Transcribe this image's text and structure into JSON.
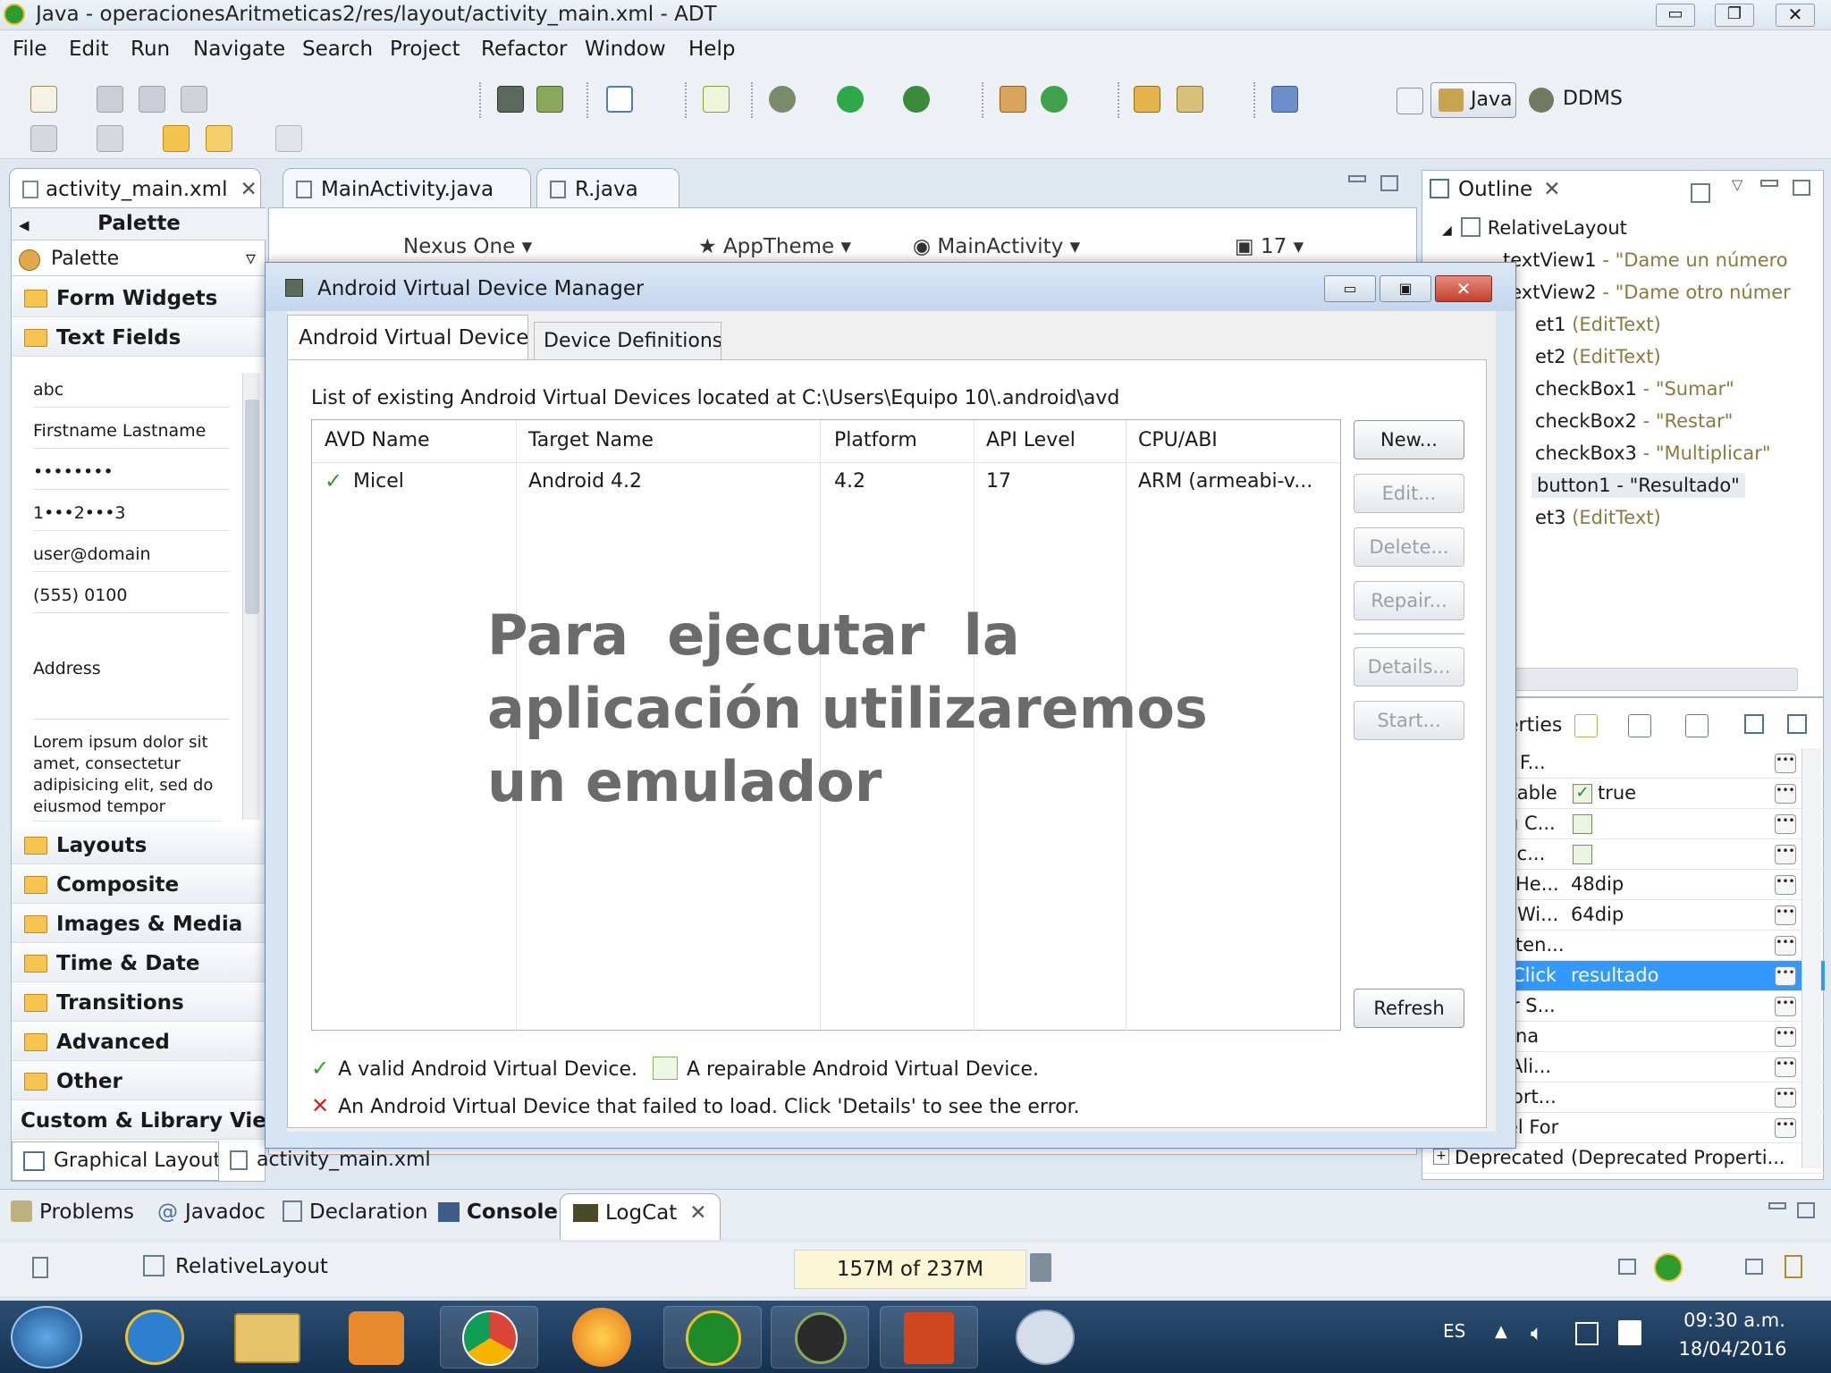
{
  "window": {
    "title": "Java - operacionesAritmeticas2/res/layout/activity_main.xml - ADT"
  },
  "menu": [
    "File",
    "Edit",
    "Run",
    "Navigate",
    "Search",
    "Project",
    "Refactor",
    "Window",
    "Help"
  ],
  "perspectives": {
    "java": "Java",
    "ddms": "DDMS"
  },
  "editor_tabs": [
    "activity_main.xml",
    "MainActivity.java",
    "R.java"
  ],
  "palette": {
    "header": "Palette",
    "dropdown_label": "Palette",
    "folders_top": [
      "Form Widgets",
      "Text Fields"
    ],
    "text_fields": [
      "abc",
      "Firstname Lastname",
      "••••••••",
      "1•••2•••3",
      "user@domain",
      "(555) 0100",
      "Address"
    ],
    "lorem": "Lorem ipsum dolor sit amet, consectetur adipisicing elit, sed do eiusmod tempor",
    "folders_bottom": [
      "Layouts",
      "Composite",
      "Images & Media",
      "Time & Date",
      "Transitions",
      "Advanced",
      "Other"
    ],
    "custom": "Custom & Library Views"
  },
  "editor_toolbar": {
    "device": "Nexus One",
    "theme": "AppTheme",
    "activity": "MainActivity",
    "api": "17"
  },
  "layout_tabs": [
    "Graphical Layout",
    "activity_main.xml"
  ],
  "outline": {
    "title": "Outline",
    "root": "RelativeLayout",
    "items": [
      {
        "id": "textView1",
        "desc": " - \"Dame un número"
      },
      {
        "id": "textView2",
        "desc": " - \"Dame otro númer"
      },
      {
        "id": "et1",
        "desc": " (EditText)"
      },
      {
        "id": "et2",
        "desc": " (EditText)"
      },
      {
        "id": "checkBox1",
        "desc": " - \"Sumar\""
      },
      {
        "id": "checkBox2",
        "desc": " - \"Restar\""
      },
      {
        "id": "checkBox3",
        "desc": " - \"Multiplicar\""
      },
      {
        "id": "button1",
        "desc": " - \"Resultado\""
      },
      {
        "id": "et3",
        "desc": " (EditText)"
      }
    ]
  },
  "properties": {
    "title": "erties",
    "rows": [
      {
        "name": "t F...",
        "value": ""
      },
      {
        "name": "kable",
        "value": "true"
      },
      {
        "name": "g C...",
        "value": ""
      },
      {
        "name": "lic...",
        "value": ""
      },
      {
        "name": "He...",
        "value": "48dip"
      },
      {
        "name": "Wi...",
        "value": "64dip"
      },
      {
        "name": "ten...",
        "value": ""
      },
      {
        "name": "Click",
        "value": "resultado"
      },
      {
        "name": "r S...",
        "value": ""
      },
      {
        "name": "na",
        "value": ""
      },
      {
        "name": "Ali...",
        "value": ""
      },
      {
        "name": "ort...",
        "value": ""
      },
      {
        "name": "el For",
        "value": ""
      }
    ],
    "deprecated_label": "Deprecated",
    "deprecated_value": "(Deprecated Properti..."
  },
  "dialog": {
    "title": "Android Virtual Device Manager",
    "tabs": [
      "Android Virtual Devices",
      "Device Definitions"
    ],
    "description": "List of existing Android Virtual Devices located at C:\\Users\\Equipo 10\\.android\\avd",
    "columns": [
      "AVD Name",
      "Target Name",
      "Platform",
      "API Level",
      "CPU/ABI"
    ],
    "row": {
      "name": "Micel",
      "target": "Android 4.2",
      "platform": "4.2",
      "api": "17",
      "cpu": "ARM (armeabi-v..."
    },
    "buttons": [
      "New...",
      "Edit...",
      "Delete...",
      "Repair...",
      "Details...",
      "Start..."
    ],
    "refresh": "Refresh",
    "legend_valid": "A valid Android Virtual Device.",
    "legend_repairable": "A repairable Android Virtual Device.",
    "legend_failed": "An Android Virtual Device that failed to load. Click 'Details' to see the error."
  },
  "overlay_text": [
    "Para  ejecutar  la",
    "aplicación utilizaremos",
    "un emulador"
  ],
  "bottom_tabs": [
    "Problems",
    "Javadoc",
    "Declaration",
    "Console",
    "LogCat"
  ],
  "status": {
    "selection": "RelativeLayout",
    "heap": "157M of 237M"
  },
  "taskbar": {
    "lang": "ES",
    "time": "09:30 a.m.",
    "date": "18/04/2016"
  },
  "colors": {
    "selection": "#3399ff",
    "valid_check": "#2e9e2e",
    "failed_x": "#d42020",
    "overlay": "#6b6b6b"
  }
}
